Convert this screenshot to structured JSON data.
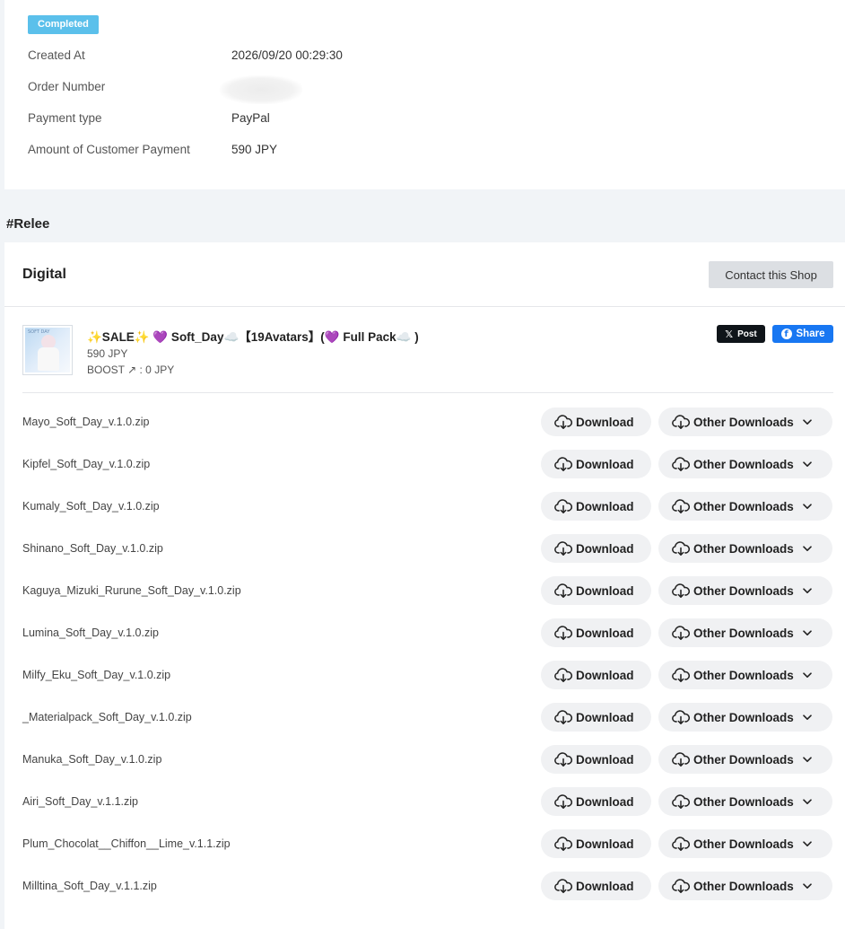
{
  "order": {
    "status": "Completed",
    "rows": [
      {
        "label": "Created At",
        "value": "2026/09/20 00:29:30"
      },
      {
        "label": "Order Number",
        "value": ""
      },
      {
        "label": "Payment type",
        "value": "PayPal"
      },
      {
        "label": "Amount of Customer Payment",
        "value": "590 JPY"
      }
    ]
  },
  "shop": {
    "name": "#Relee",
    "section_title": "Digital",
    "contact_label": "Contact this Shop"
  },
  "product": {
    "thumb_text": "SOFT DAY",
    "title": "✨SALE✨ 💜 Soft_Day☁️【19Avatars】(💜 Full Pack☁️ )",
    "price": "590 JPY",
    "boost": "BOOST ↗ : 0 JPY",
    "x_post_label": "Post",
    "x_logo": "𝕏",
    "fb_share_label": "Share",
    "fb_logo": "f"
  },
  "downloads": {
    "download_label": "Download",
    "other_label": "Other Downloads",
    "files": [
      "Mayo_Soft_Day_v.1.0.zip",
      "Kipfel_Soft_Day_v.1.0.zip",
      "Kumaly_Soft_Day_v.1.0.zip",
      "Shinano_Soft_Day_v.1.0.zip",
      "Kaguya_Mizuki_Rurune_Soft_Day_v.1.0.zip",
      "Lumina_Soft_Day_v.1.0.zip",
      "Milfy_Eku_Soft_Day_v.1.0.zip",
      "_Materialpack_Soft_Day_v.1.0.zip",
      "Manuka_Soft_Day_v.1.0.zip",
      "Airi_Soft_Day_v.1.1.zip",
      "Plum_Chocolat__Chiffon__Lime_v.1.1.zip",
      "Milltina_Soft_Day_v.1.1.zip"
    ]
  },
  "colors": {
    "status_badge": "#5bc0eb",
    "fb_blue": "#1877f2",
    "x_black": "#0f1419",
    "page_bg": "#f1f4f7"
  },
  "icons": [
    "cloud-download-icon",
    "chevron-down-icon",
    "x-logo-icon",
    "facebook-icon"
  ]
}
